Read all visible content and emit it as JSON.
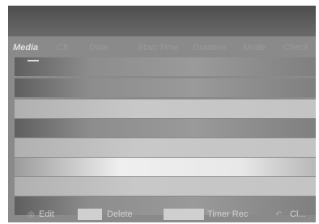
{
  "header": {
    "media": "Media",
    "ch": "Ch.",
    "date": "Date",
    "start_time": "Start Time",
    "duration": "Duration",
    "mode": "Mode",
    "check": "Check"
  },
  "footer": {
    "edit": "Edit",
    "delete": "Delete",
    "timer_rec": "Timer Rec",
    "close": "Cl..."
  },
  "icons": {
    "edit_icon": "circle-icon",
    "close_icon": "return-icon"
  },
  "colors": {
    "selection_highlight": "#f0f0f0",
    "title_bar": "#555555"
  }
}
